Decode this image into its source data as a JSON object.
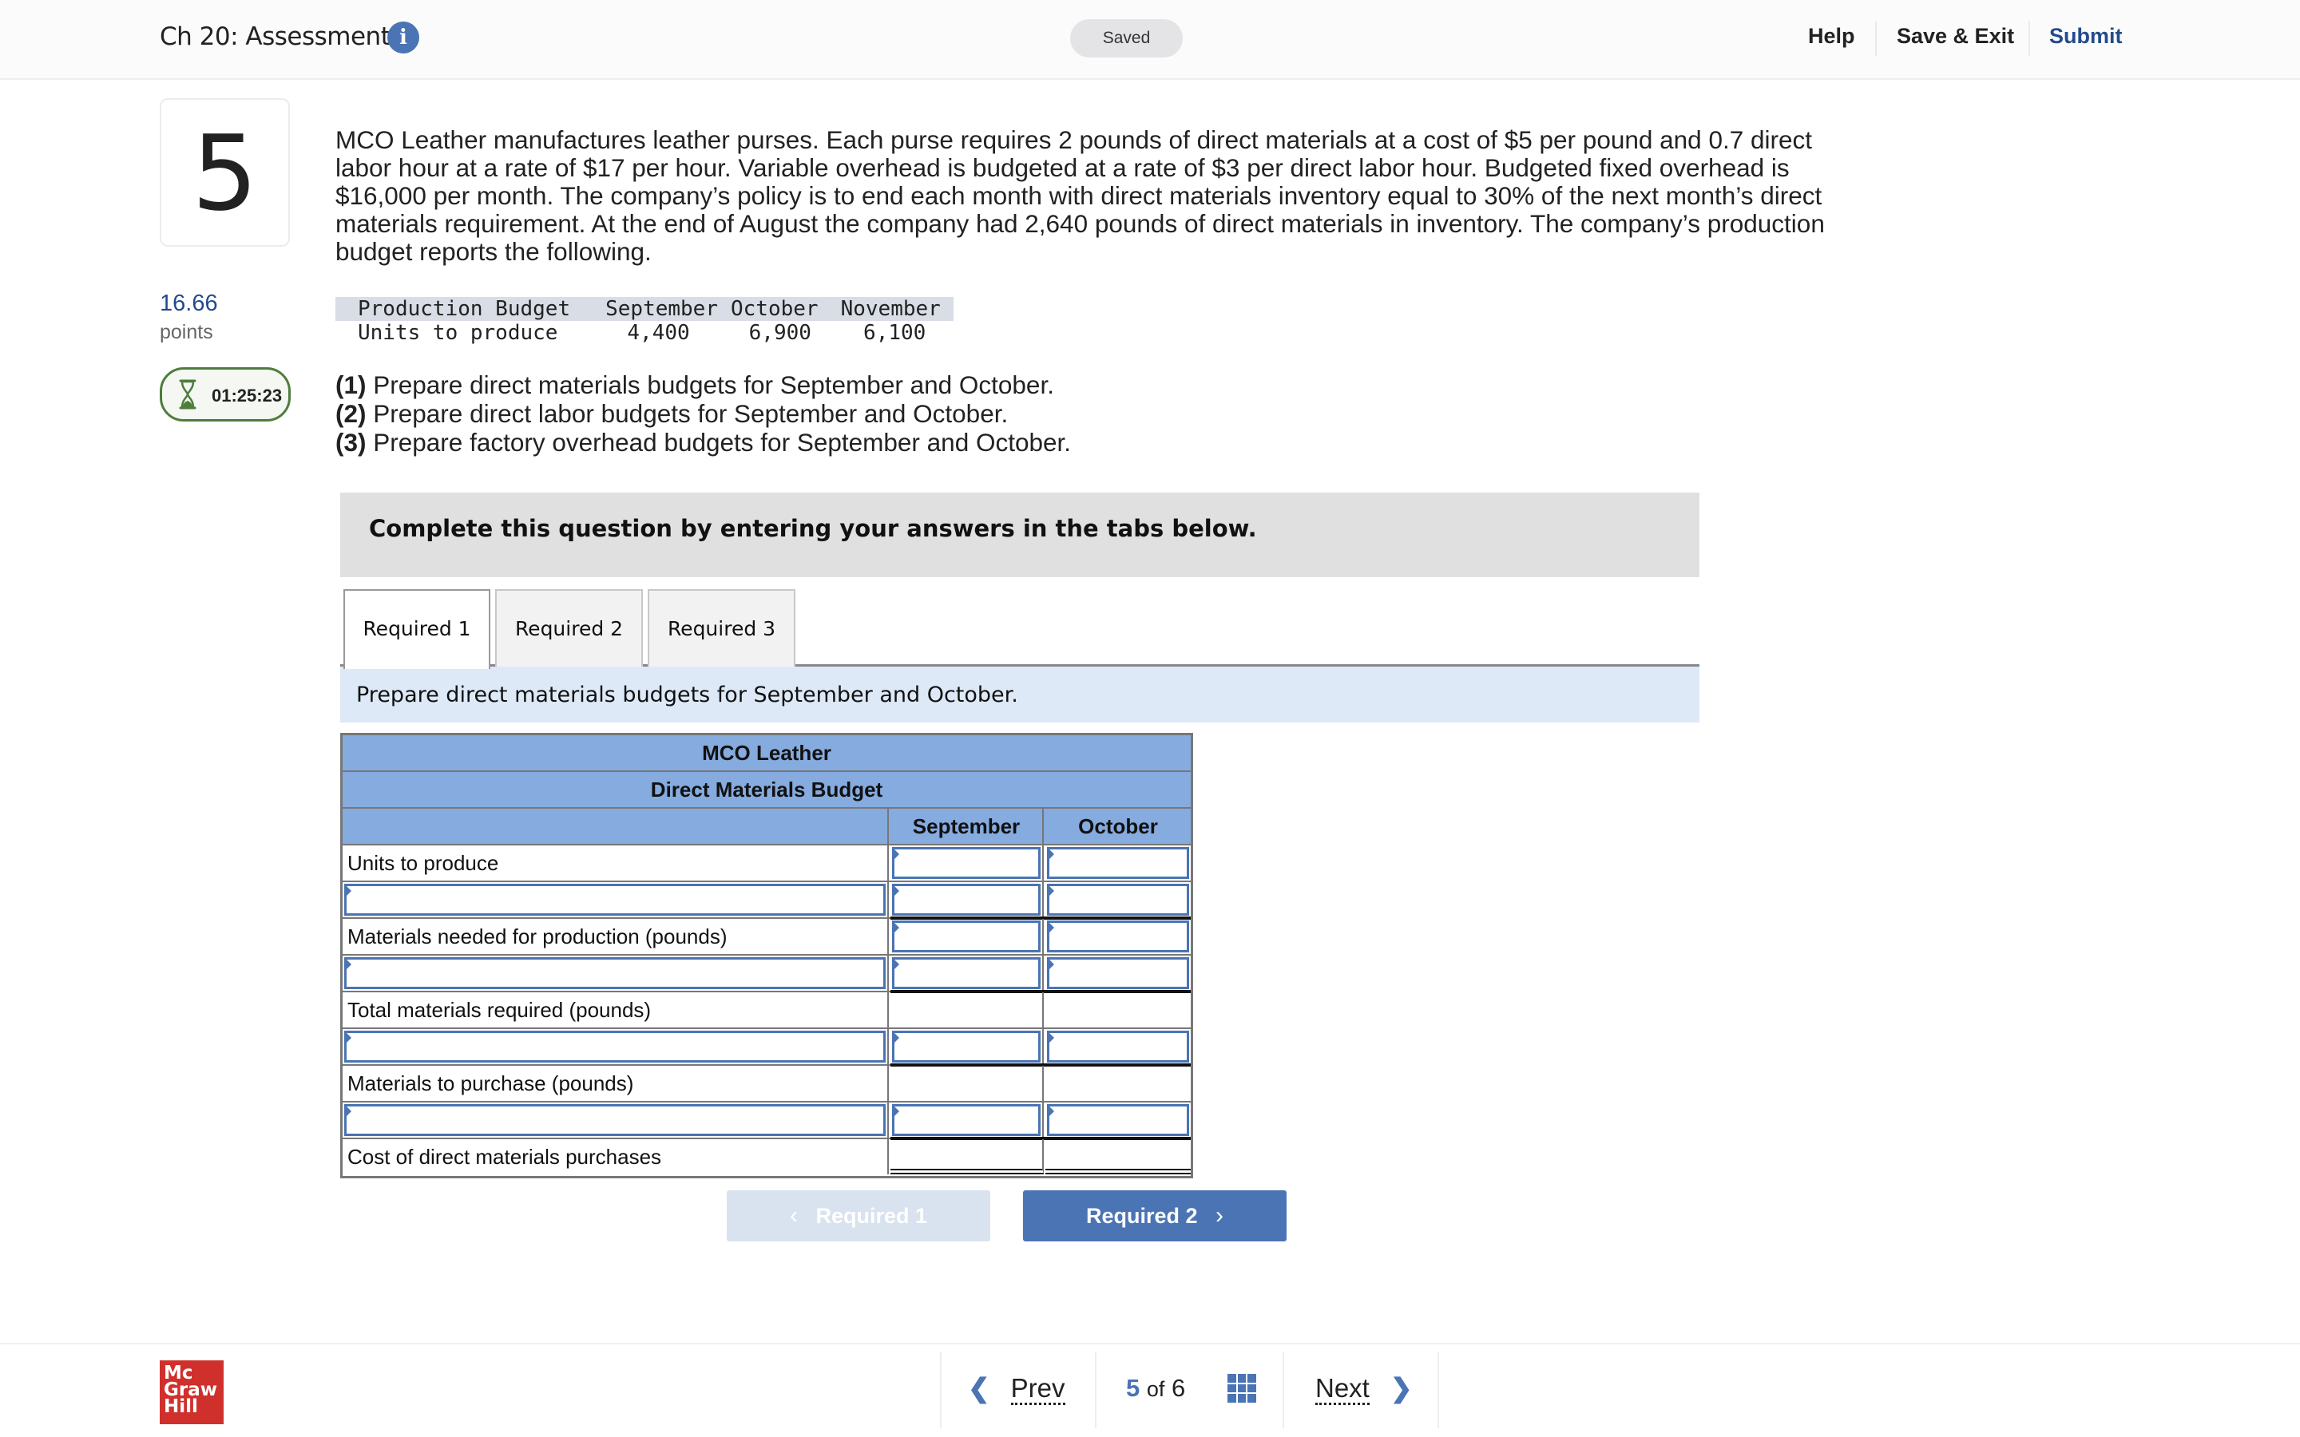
{
  "header": {
    "title": "Ch 20: Assessment",
    "info_icon": "info-icon",
    "status": "Saved",
    "links": {
      "help": "Help",
      "save_exit": "Save & Exit",
      "submit": "Submit"
    }
  },
  "question": {
    "number": "5",
    "points_value": "16.66",
    "points_label": "points",
    "timer": "01:25:23",
    "timer_icon": "hourglass-icon",
    "text": "MCO Leather manufactures leather purses. Each purse requires 2 pounds of direct materials at a cost of $5 per pound and 0.7 direct labor hour at a rate of $17 per hour. Variable overhead is budgeted at a rate of $3 per direct labor hour. Budgeted fixed overhead is $16,000 per month. The company’s policy is to end each month with direct materials inventory equal to 30% of the next month’s direct materials requirement. At the end of August the company had 2,640 pounds of direct materials in inventory. The company’s production budget reports the following.",
    "production_budget": {
      "headers": [
        "Production Budget",
        "September",
        "October",
        "November"
      ],
      "row": [
        "Units to produce",
        "4,400",
        "6,900",
        "6,100"
      ]
    },
    "requirements": [
      {
        "num": "(1)",
        "text": " Prepare direct materials budgets for September and October."
      },
      {
        "num": "(2)",
        "text": " Prepare direct labor budgets for September and October."
      },
      {
        "num": "(3)",
        "text": " Prepare factory overhead budgets for September and October."
      }
    ]
  },
  "instruction": "Complete this question by entering your answers in the tabs below.",
  "tabs": [
    {
      "label": "Required 1",
      "active": true
    },
    {
      "label": "Required 2",
      "active": false
    },
    {
      "label": "Required 3",
      "active": false
    }
  ],
  "tab_prompt": "Prepare direct materials budgets for September and October.",
  "budget_table": {
    "company": "MCO Leather",
    "title": "Direct Materials Budget",
    "columns": [
      "September",
      "October"
    ],
    "rows": [
      {
        "label": "Units to produce",
        "label_editable": false,
        "september": "",
        "october": ""
      },
      {
        "label": "",
        "label_editable": true,
        "september": "",
        "october": ""
      },
      {
        "label": "Materials needed for production (pounds)",
        "label_editable": false,
        "september": "",
        "october": ""
      },
      {
        "label": "",
        "label_editable": true,
        "september": "",
        "october": ""
      },
      {
        "label": "Total materials required (pounds)",
        "label_editable": false,
        "september": "",
        "october": ""
      },
      {
        "label": "",
        "label_editable": true,
        "september": "",
        "october": ""
      },
      {
        "label": "Materials to purchase (pounds)",
        "label_editable": false,
        "september": "",
        "october": ""
      },
      {
        "label": "",
        "label_editable": true,
        "september": "",
        "october": ""
      },
      {
        "label": "Cost of direct materials purchases",
        "label_editable": false,
        "september": "",
        "october": ""
      }
    ]
  },
  "nav_buttons": {
    "prev": {
      "label": "Required 1",
      "enabled": false
    },
    "next": {
      "label": "Required 2",
      "enabled": true
    }
  },
  "footer": {
    "logo_lines": [
      "Mc",
      "Graw",
      "Hill"
    ],
    "prev": "Prev",
    "current": "5",
    "of": "of",
    "total": "6",
    "next": "Next",
    "grid_icon": "grid-icon"
  },
  "colors": {
    "accent": "#4a74b4",
    "submit_link": "#234b8c",
    "table_header": "#85abdf",
    "tab_prompt_bg": "#dde9f7",
    "timer_border": "#4e7d3c",
    "logo_red": "#d0302c"
  }
}
